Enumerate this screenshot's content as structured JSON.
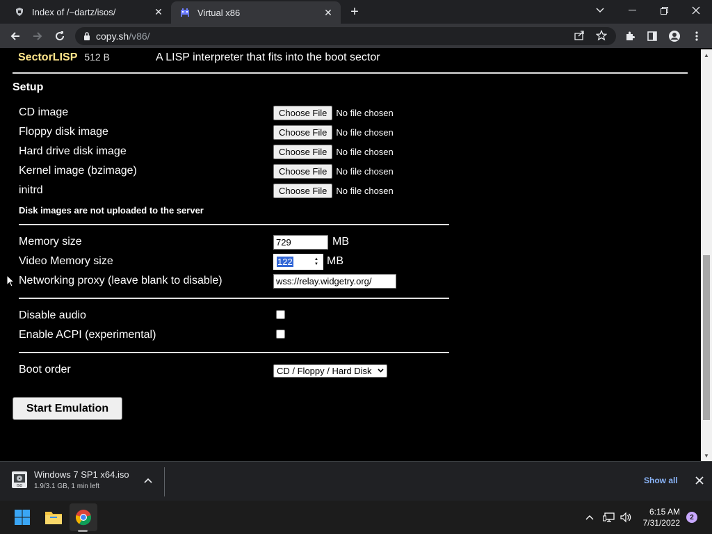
{
  "browser": {
    "tabs": [
      {
        "title": "Index of /~dartz/isos/",
        "favicon": "server-icon"
      },
      {
        "title": "Virtual x86",
        "favicon": "space-invader-icon",
        "active": true
      }
    ],
    "url": {
      "host": "copy.sh",
      "path": "/v86/"
    }
  },
  "page": {
    "os_row": {
      "name": "SectorLISP",
      "size": "512 B",
      "description": "A LISP interpreter that fits into the boot sector"
    },
    "setup_heading": "Setup",
    "file_inputs": [
      {
        "label": "CD image",
        "button": "Choose File",
        "status": "No file chosen"
      },
      {
        "label": "Floppy disk image",
        "button": "Choose File",
        "status": "No file chosen"
      },
      {
        "label": "Hard drive disk image",
        "button": "Choose File",
        "status": "No file chosen"
      },
      {
        "label": "Kernel image (bzimage)",
        "button": "Choose File",
        "status": "No file chosen"
      },
      {
        "label": "initrd",
        "button": "Choose File",
        "status": "No file chosen"
      }
    ],
    "upload_note": "Disk images are not uploaded to the server",
    "memory": {
      "label": "Memory size",
      "value": "729",
      "unit": "MB"
    },
    "video_memory": {
      "label": "Video Memory size",
      "value": "122",
      "unit": "MB"
    },
    "networking": {
      "label": "Networking proxy (leave blank to disable)",
      "value": "wss://relay.widgetry.org/"
    },
    "disable_audio": {
      "label": "Disable audio",
      "checked": false
    },
    "enable_acpi": {
      "label": "Enable ACPI (experimental)",
      "checked": false
    },
    "boot_order": {
      "label": "Boot order",
      "selected": "CD / Floppy / Hard Disk"
    },
    "start_button": "Start Emulation"
  },
  "downloads": {
    "filename": "Windows 7 SP1 x64.iso",
    "status": "1.9/3.1 GB, 1 min left",
    "show_all": "Show all"
  },
  "taskbar": {
    "time": "6:15 AM",
    "date": "7/31/2022",
    "notifications": "2"
  }
}
